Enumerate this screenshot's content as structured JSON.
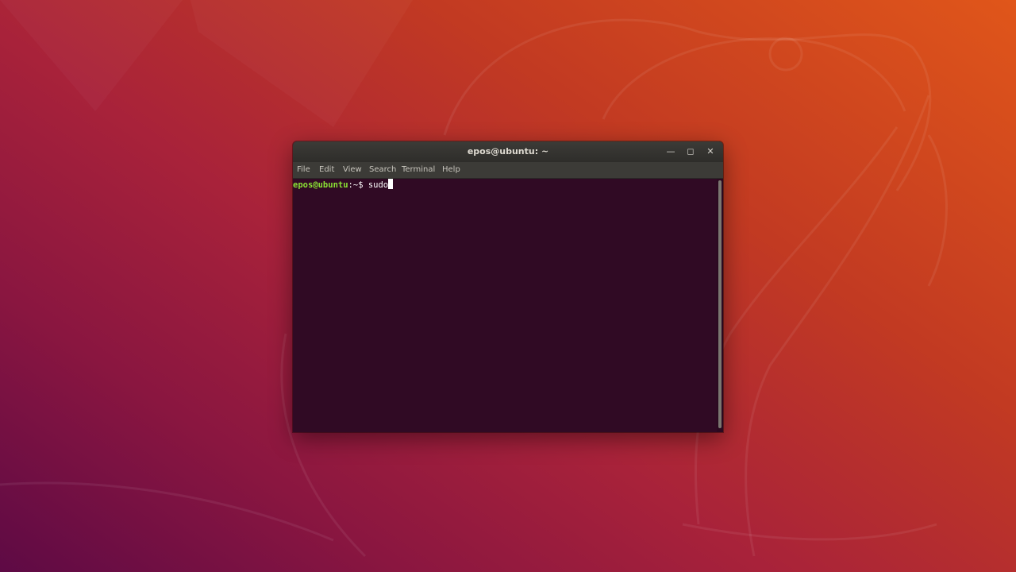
{
  "desktop": {
    "wallpaper": "ubuntu-18.04-bionic-beaver",
    "colors": {
      "gradient_start": "#5e0a45",
      "gradient_end": "#e0561a"
    }
  },
  "window": {
    "title": "epos@ubuntu: ~",
    "controls": {
      "minimize_icon": "minimize-icon",
      "maximize_icon": "maximize-icon",
      "close_icon": "close-icon"
    },
    "menu": [
      {
        "label": "File"
      },
      {
        "label": "Edit"
      },
      {
        "label": "View"
      },
      {
        "label": "Search"
      },
      {
        "label": "Terminal"
      },
      {
        "label": "Help"
      }
    ]
  },
  "terminal": {
    "prompt_user_host": "epos@ubuntu",
    "prompt_path": ":~$ ",
    "command": "sudo",
    "colors": {
      "background": "#300a24",
      "prompt_user": "#8ae234",
      "text": "#ffffff"
    }
  }
}
